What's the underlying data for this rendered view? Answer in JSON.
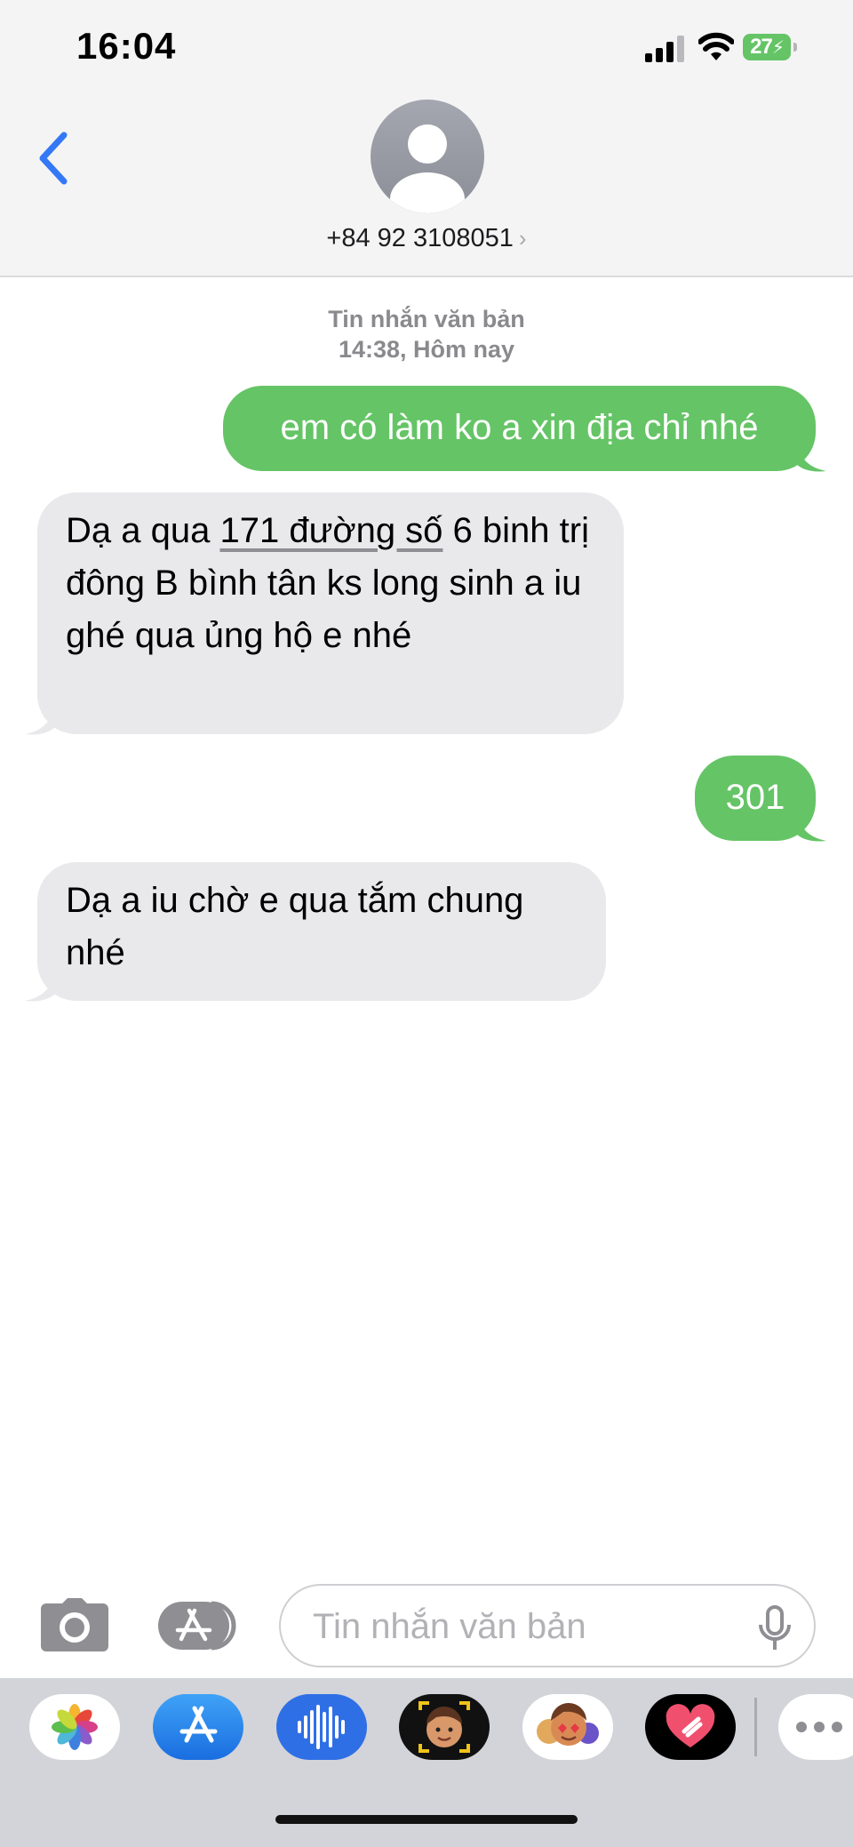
{
  "status_bar": {
    "time": "16:04",
    "battery": "27"
  },
  "header": {
    "contact": "+84 92 3108051",
    "chevron": "›"
  },
  "timestamp": {
    "label": "Tin nhắn văn bản",
    "time": "14:38, Hôm nay"
  },
  "messages": [
    {
      "direction": "outgoing",
      "text": "em có làm ko a xin địa chỉ nhé"
    },
    {
      "direction": "incoming",
      "text_before": "Dạ a qua ",
      "link": "171 đường số",
      "text_after": " 6 binh trị đông B bình tân ks long sinh a iu ghé qua ủng hộ e nhé"
    },
    {
      "direction": "outgoing",
      "text": "301"
    },
    {
      "direction": "incoming",
      "text": "Dạ a iu chờ e qua tắm chung nhé"
    }
  ],
  "composer": {
    "placeholder": "Tin nhắn văn bản"
  },
  "drawer": {
    "apps": [
      "photos-icon",
      "app-store-icon",
      "audio-message-icon",
      "memoji-stickers-icon",
      "animoji-icon",
      "digital-touch-icon",
      "more-icon"
    ]
  },
  "colors": {
    "outgoing": "#65c466",
    "incoming": "#e9e9eb",
    "accent": "#3478f6"
  }
}
